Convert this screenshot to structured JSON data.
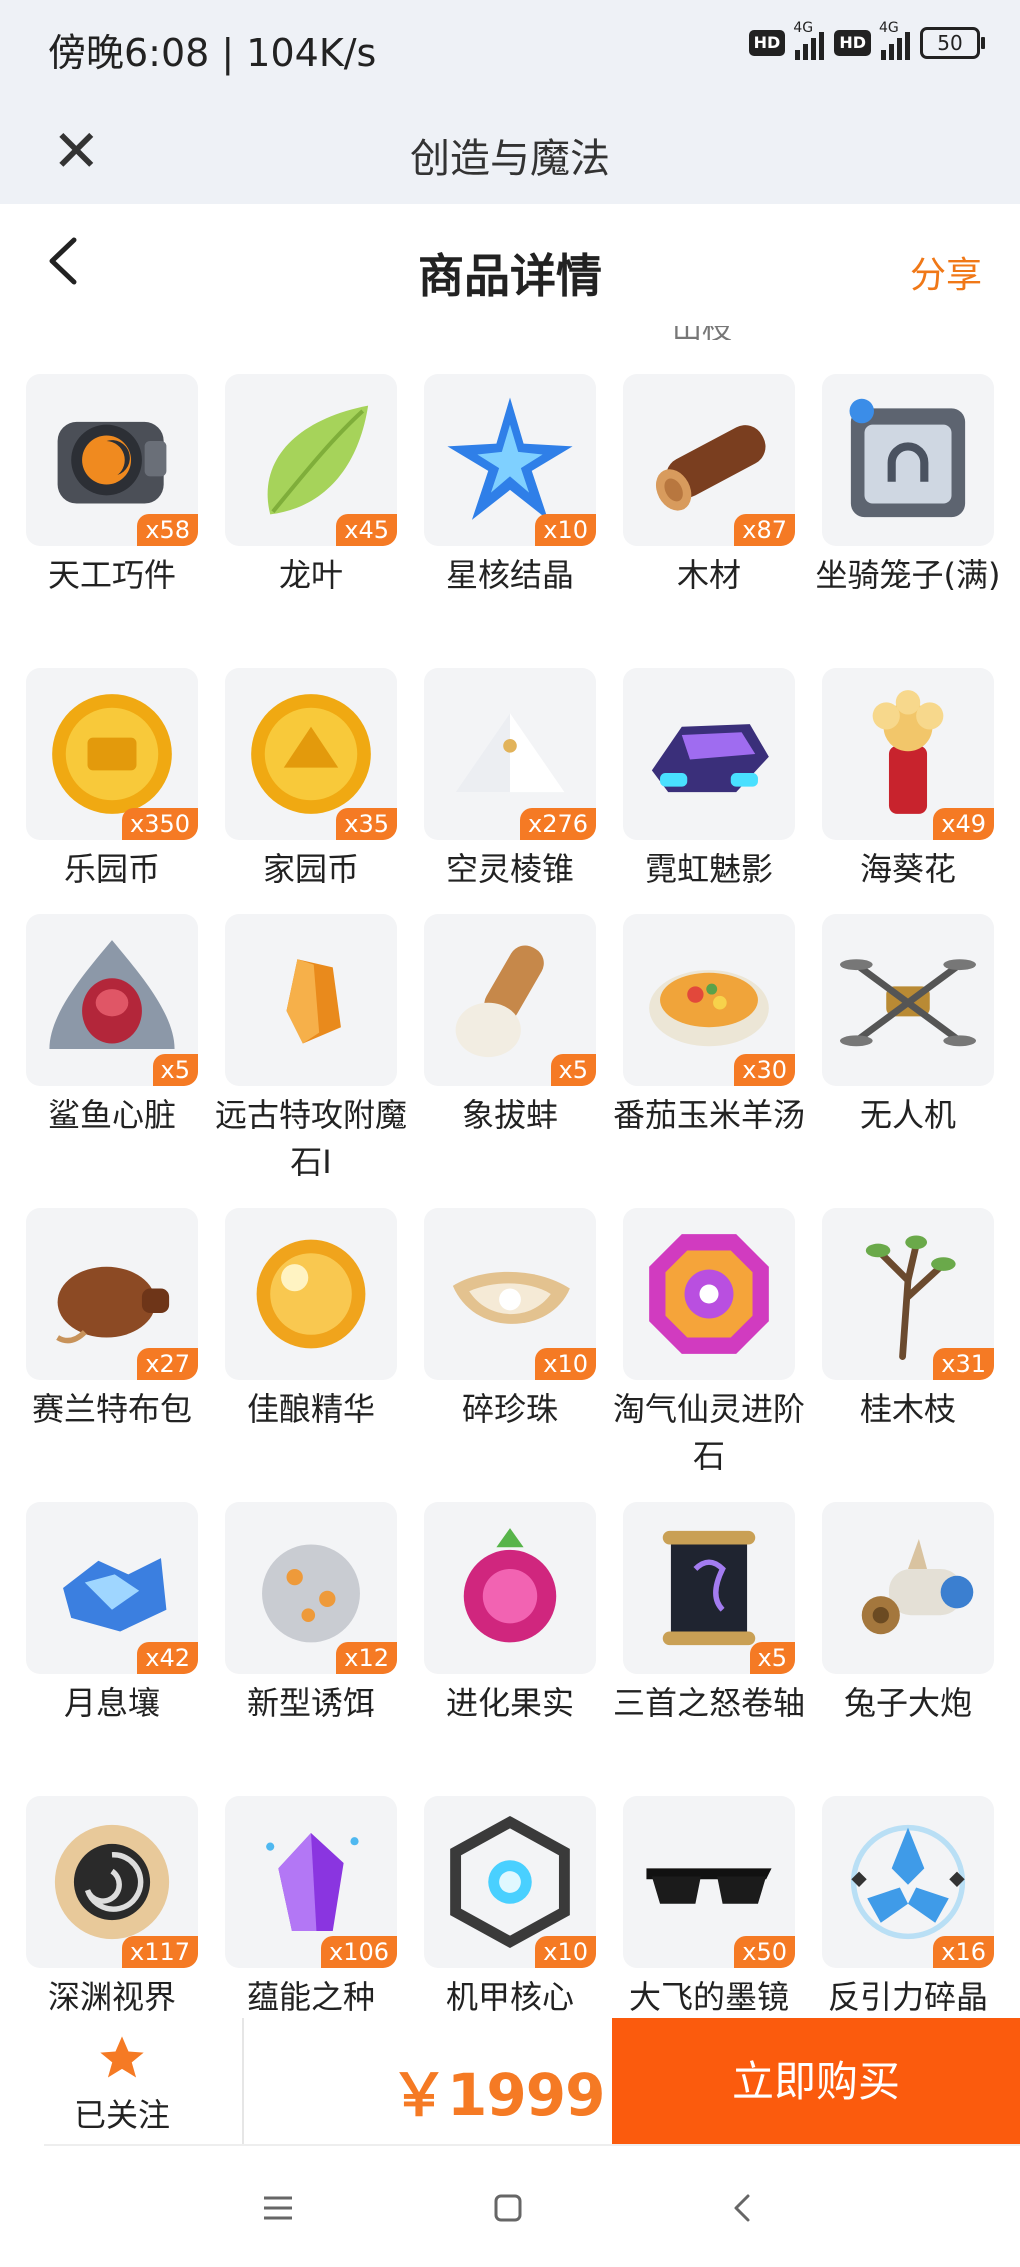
{
  "status_bar": {
    "time": "傍晚6:08 | 104K/s",
    "hd1": "HD",
    "net1": "4G",
    "hd2": "HD",
    "net2": "4G",
    "battery": "50"
  },
  "app_bar": {
    "title": "创造与魔法"
  },
  "page_header": {
    "title": "商品详情",
    "share_label": "分享",
    "cutoff_text": "山枝"
  },
  "rows": [
    {
      "items": [
        {
          "name": "天工巧件",
          "count": "x58",
          "icon": "gear-core-icon"
        },
        {
          "name": "龙叶",
          "count": "x45",
          "icon": "leaf-icon"
        },
        {
          "name": "星核结晶",
          "count": "x10",
          "icon": "star-crystal-icon"
        },
        {
          "name": "木材",
          "count": "x87",
          "icon": "wood-log-icon"
        },
        {
          "name": "坐骑笼子(满)",
          "count": "",
          "icon": "mount-cage-icon"
        }
      ]
    },
    {
      "items": [
        {
          "name": "乐园币",
          "count": "x350",
          "icon": "gold-coin-icon"
        },
        {
          "name": "家园币",
          "count": "x35",
          "icon": "gold-coin-icon"
        },
        {
          "name": "空灵棱锥",
          "count": "x276",
          "icon": "pyramid-icon"
        },
        {
          "name": "霓虹魅影",
          "count": "",
          "icon": "neon-vehicle-icon"
        },
        {
          "name": "海葵花",
          "count": "x49",
          "icon": "anemone-flower-icon"
        }
      ]
    },
    {
      "items": [
        {
          "name": "鲨鱼心脏",
          "count": "x5",
          "icon": "shark-heart-icon"
        },
        {
          "name": "远古特攻附魔石I",
          "count": "",
          "icon": "enchant-stone-icon"
        },
        {
          "name": "象拔蚌",
          "count": "x5",
          "icon": "geoduck-icon"
        },
        {
          "name": "番茄玉米羊汤",
          "count": "x30",
          "icon": "soup-bowl-icon"
        },
        {
          "name": "无人机",
          "count": "",
          "icon": "drone-icon"
        }
      ]
    },
    {
      "items": [
        {
          "name": "赛兰特布包",
          "count": "x27",
          "icon": "cloth-bag-icon"
        },
        {
          "name": "佳酿精华",
          "count": "",
          "icon": "essence-orb-icon"
        },
        {
          "name": "碎珍珠",
          "count": "x10",
          "icon": "broken-pearl-icon"
        },
        {
          "name": "淘气仙灵进阶石",
          "count": "",
          "icon": "fairy-gem-icon"
        },
        {
          "name": "桂木枝",
          "count": "x31",
          "icon": "branch-icon"
        }
      ]
    },
    {
      "items": [
        {
          "name": "月息壤",
          "count": "x42",
          "icon": "moon-soil-icon"
        },
        {
          "name": "新型诱饵",
          "count": "x12",
          "icon": "bait-icon"
        },
        {
          "name": "进化果实",
          "count": "",
          "icon": "evolution-fruit-icon"
        },
        {
          "name": "三首之怒卷轴",
          "count": "x5",
          "icon": "scroll-icon"
        },
        {
          "name": "兔子大炮",
          "count": "",
          "icon": "rabbit-cannon-icon"
        }
      ]
    },
    {
      "items": [
        {
          "name": "深渊视界",
          "count": "x117",
          "icon": "abyss-eye-icon"
        },
        {
          "name": "蕴能之种",
          "count": "x106",
          "icon": "energy-seed-icon"
        },
        {
          "name": "机甲核心",
          "count": "x10",
          "icon": "mech-core-icon"
        },
        {
          "name": "大飞的墨镜",
          "count": "x50",
          "icon": "sunglasses-icon"
        },
        {
          "name": "反引力碎晶",
          "count": "x16",
          "icon": "antigravity-shard-icon"
        }
      ]
    }
  ],
  "bottom_bar": {
    "follow_label": "已关注",
    "price": "￥1999",
    "buy_label": "立即购买"
  },
  "colors": {
    "accent": "#f57a24",
    "buy_button": "#fb5b0d",
    "tile_bg": "#f3f4f6",
    "status_bg": "#eef1f6"
  }
}
